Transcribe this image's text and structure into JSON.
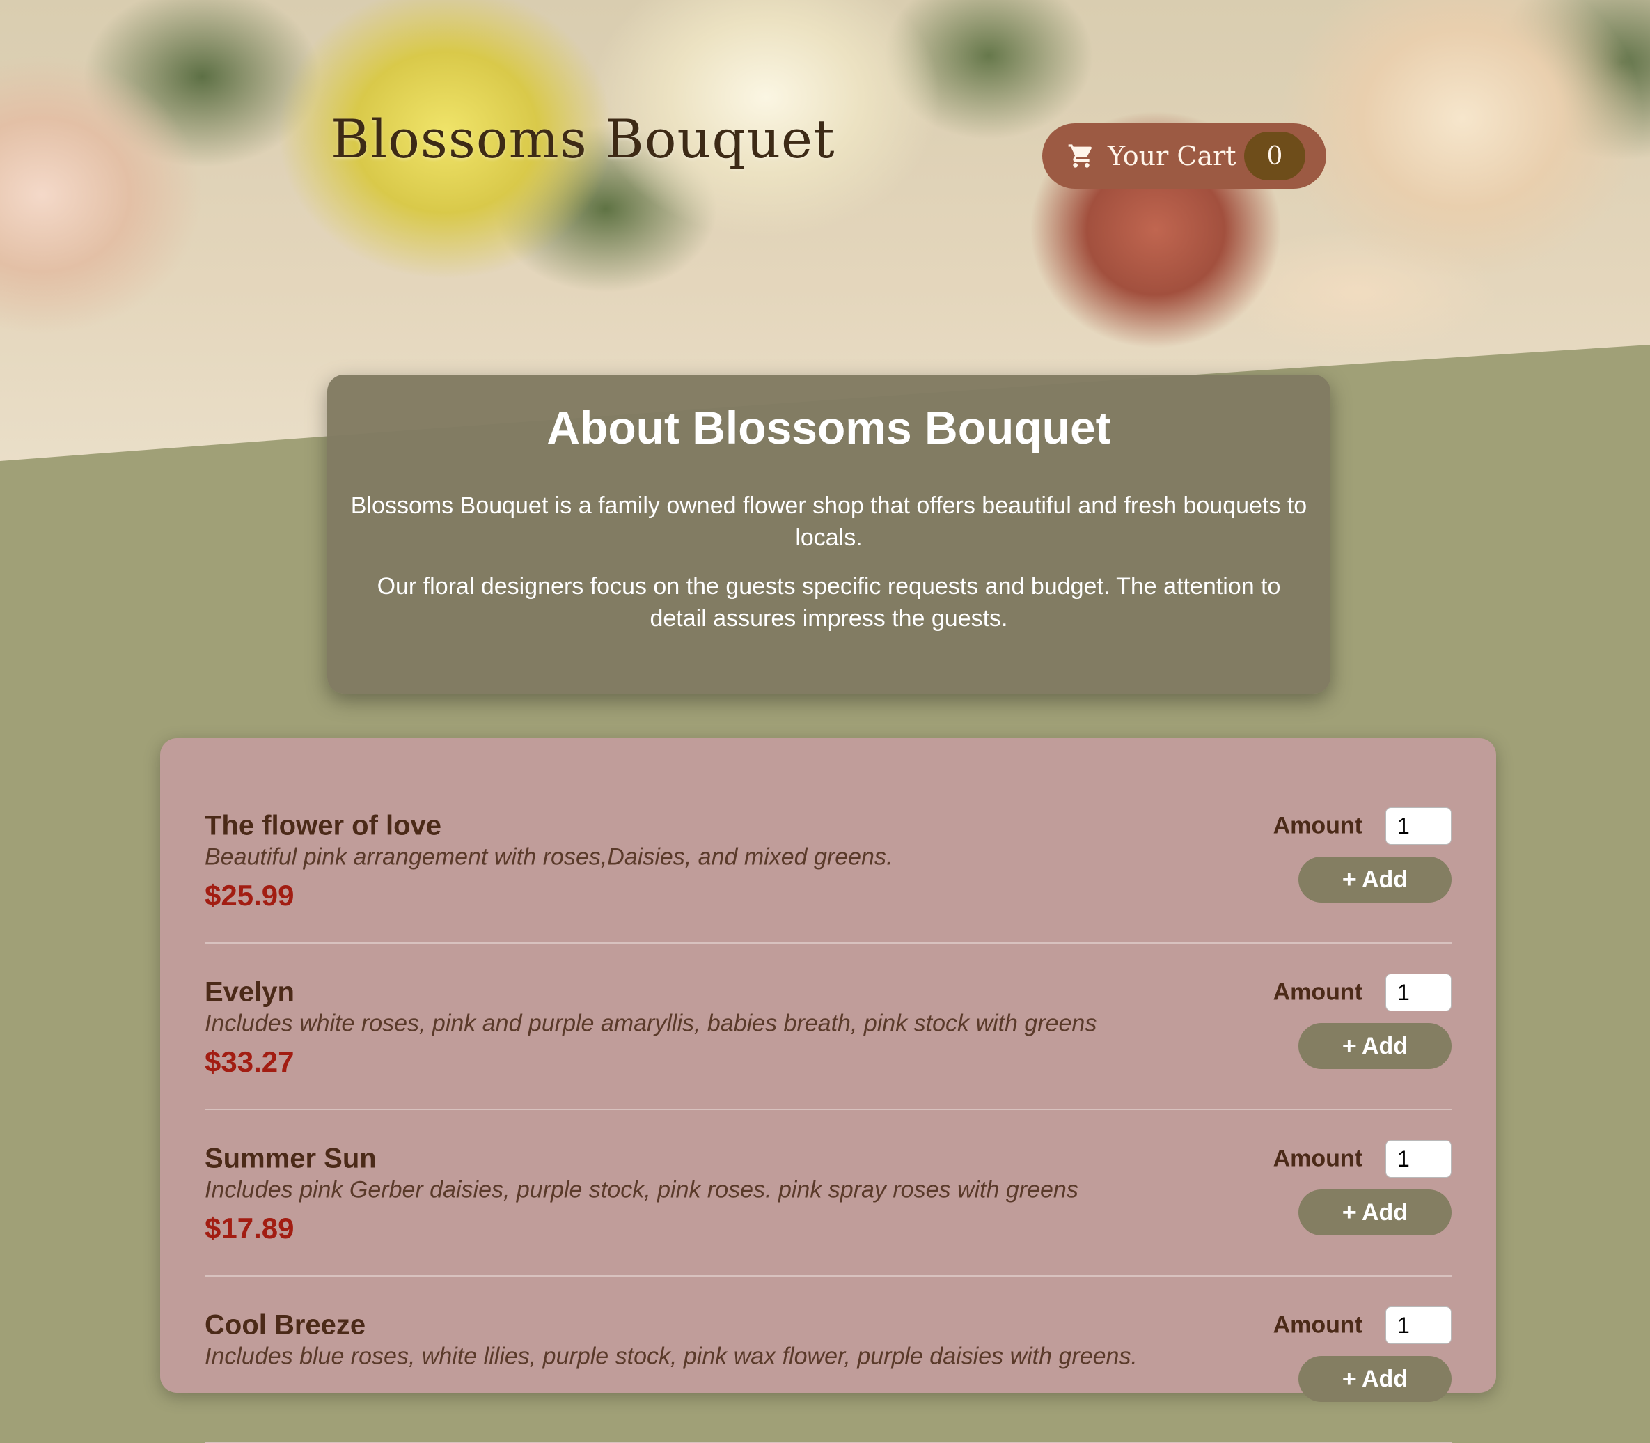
{
  "header": {
    "brand": "Blossoms Bouquet",
    "cart_label": "Your Cart",
    "cart_count": "0",
    "cart_icon": "shopping-cart-icon"
  },
  "about": {
    "title": "About Blossoms Bouquet",
    "paragraphs": [
      "Blossoms Bouquet is a family owned flower shop that offers beautiful and fresh bouquets to locals.",
      "Our floral designers focus on the guests specific requests and budget. The attention to detail assures impress the guests."
    ]
  },
  "products": [
    {
      "name": "The flower of love",
      "description": "Beautiful pink arrangement with roses,Daisies, and mixed greens.",
      "price": "$25.99",
      "amount_label": "Amount",
      "amount_value": "1",
      "add_label": "+ Add"
    },
    {
      "name": "Evelyn",
      "description": "Includes white roses, pink and purple amaryllis, babies breath, pink stock with greens",
      "price": "$33.27",
      "amount_label": "Amount",
      "amount_value": "1",
      "add_label": "+ Add"
    },
    {
      "name": "Summer Sun",
      "description": "Includes pink Gerber daisies, purple stock, pink roses. pink spray roses with greens",
      "price": "$17.89",
      "amount_label": "Amount",
      "amount_value": "1",
      "add_label": "+ Add"
    },
    {
      "name": "Cool Breeze",
      "description": "Includes blue roses, white lilies, purple stock, pink wax flower, purple daisies with greens.",
      "price": "",
      "amount_label": "Amount",
      "amount_value": "1",
      "add_label": "+ Add"
    }
  ],
  "colors": {
    "page_background": "#a0a077",
    "cart_button": "#9c5a43",
    "cart_badge": "#6e4d1a",
    "about_card": "#817b62",
    "menu_card": "#c09d9a",
    "price": "#a21d12",
    "add_button": "#847e62"
  }
}
